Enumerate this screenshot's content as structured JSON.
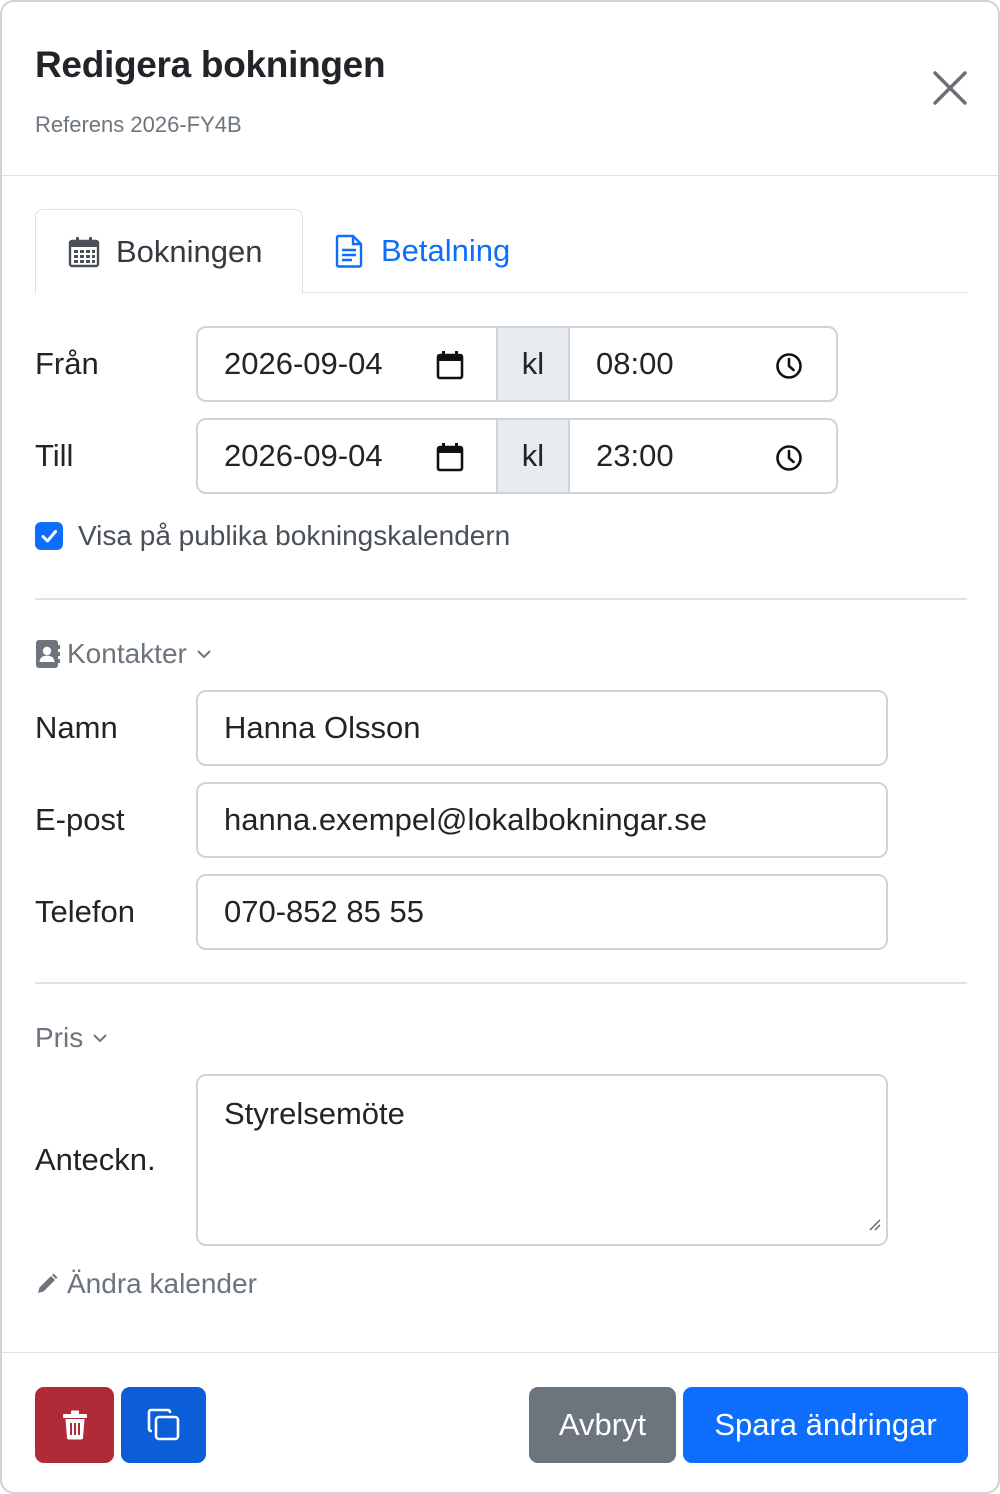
{
  "header": {
    "title": "Redigera bokningen",
    "subtitle": "Referens 2026-FY4B",
    "close_icon": "close-icon"
  },
  "tabs": [
    {
      "label": "Bokningen",
      "icon": "calendar-icon",
      "active": true
    },
    {
      "label": "Betalning",
      "icon": "document-icon",
      "active": false
    }
  ],
  "booking": {
    "from": {
      "label": "Från",
      "date": "2026-09-04",
      "separator": "kl",
      "time": "08:00"
    },
    "to": {
      "label": "Till",
      "date": "2026-09-04",
      "separator": "kl",
      "time": "23:00"
    },
    "public_checkbox": {
      "label": "Visa på publika bokningskalendern",
      "checked": true
    }
  },
  "contacts": {
    "section_label": "Kontakter",
    "name": {
      "label": "Namn",
      "value": "Hanna Olsson"
    },
    "email": {
      "label": "E-post",
      "value": "hanna.exempel@lokalbokningar.se"
    },
    "phone": {
      "label": "Telefon",
      "value": "070-852 85 55"
    }
  },
  "price": {
    "section_label": "Pris"
  },
  "notes": {
    "label": "Anteckn.",
    "value": "Styrelsemöte"
  },
  "change_calendar_label": "Ändra kalender",
  "footer": {
    "cancel_label": "Avbryt",
    "save_label": "Spara ändringar",
    "delete_icon": "trash-icon",
    "copy_icon": "copy-icon"
  },
  "colors": {
    "primary": "#0d6efd",
    "danger": "#b02a37",
    "secondary": "#6c757d"
  }
}
